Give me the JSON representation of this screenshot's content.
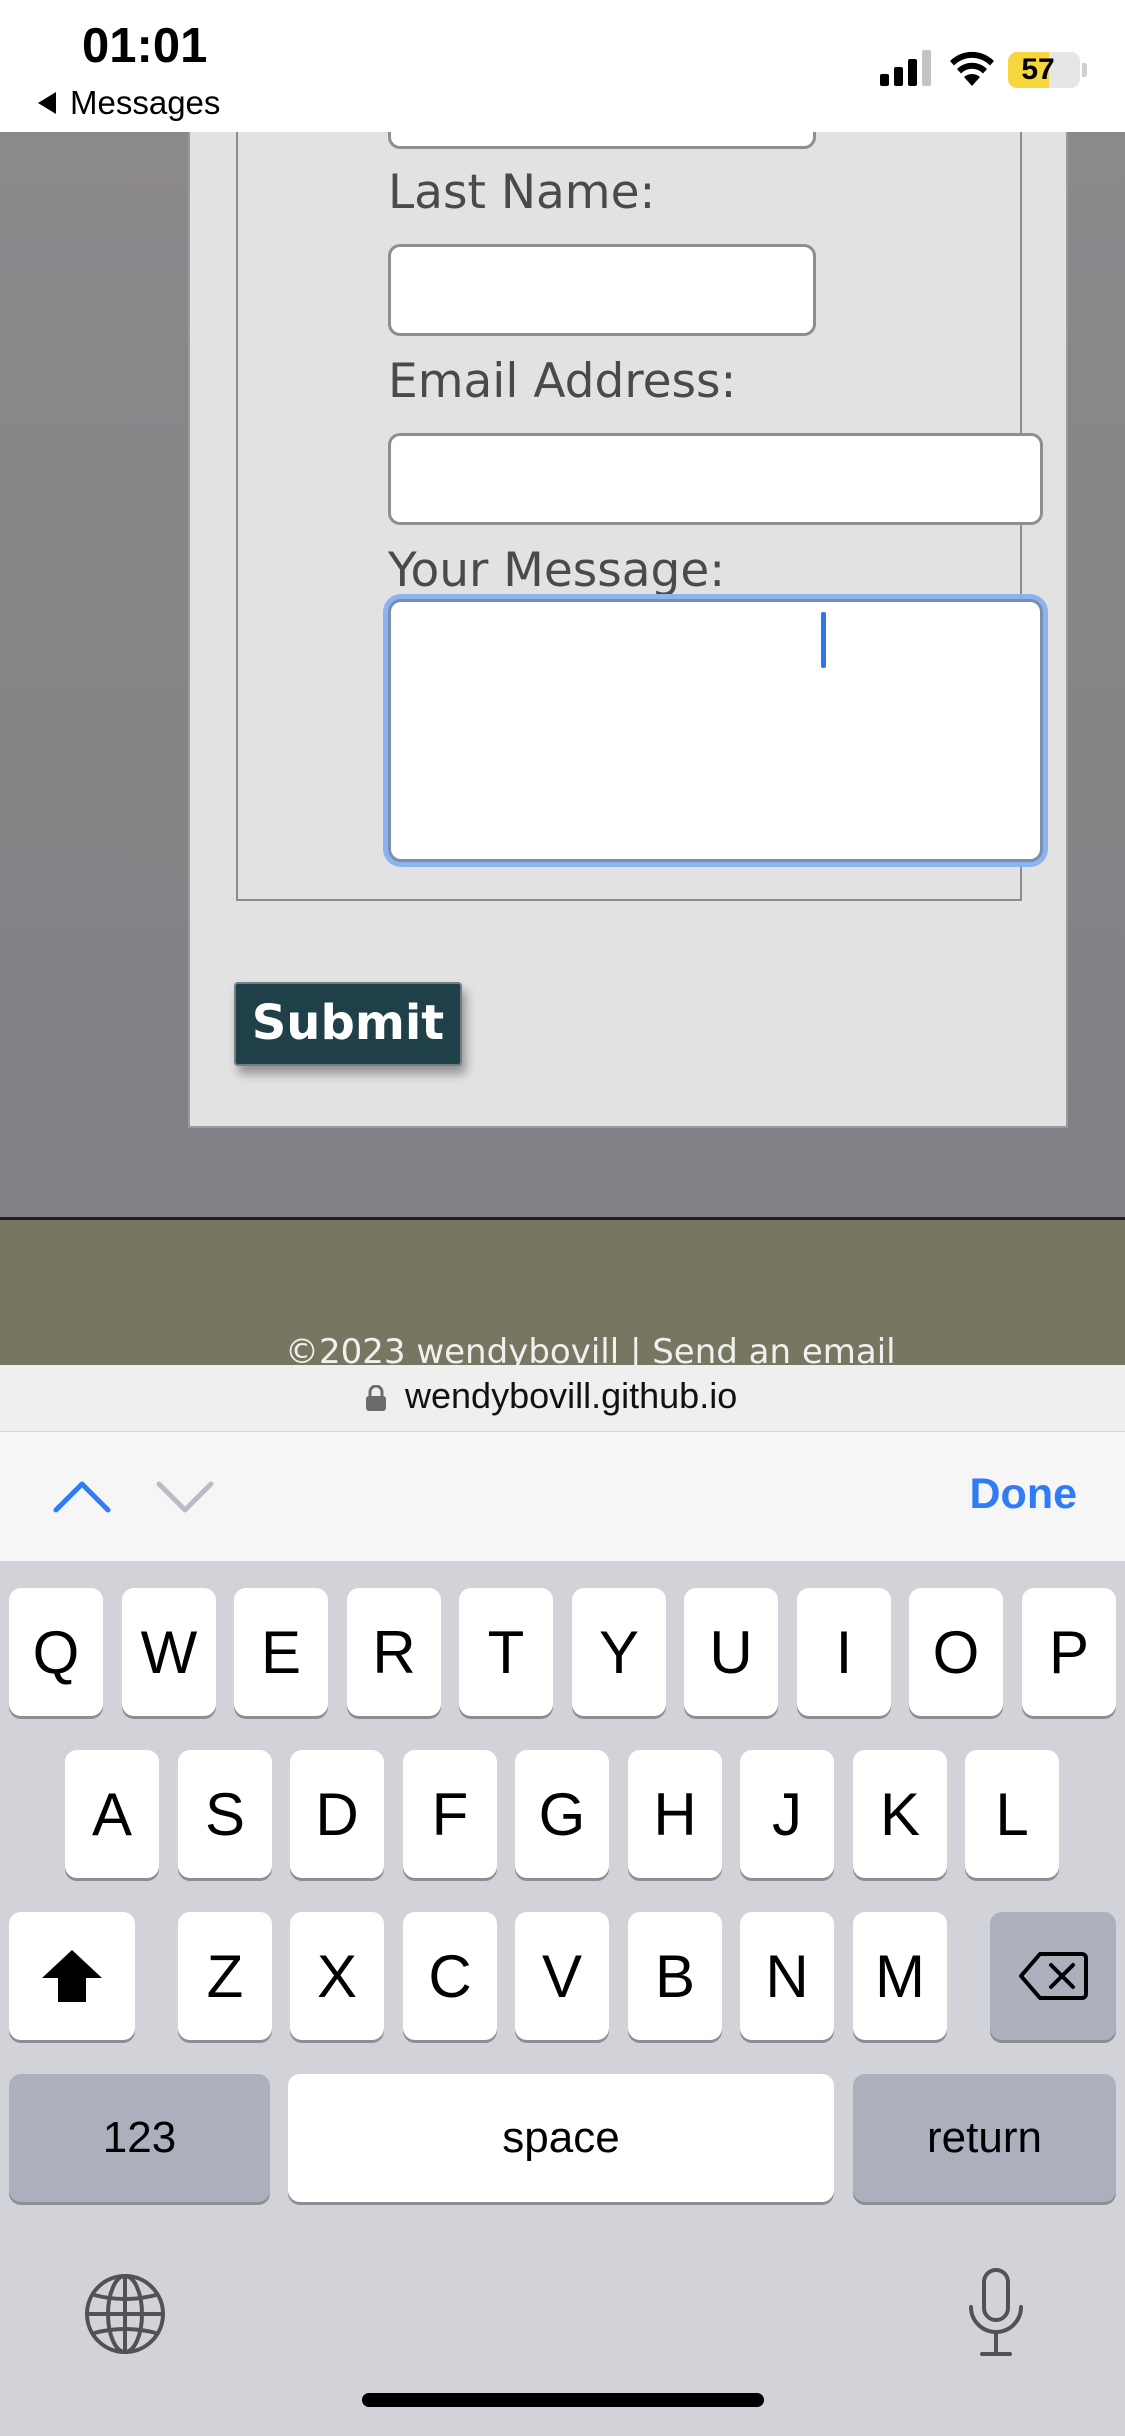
{
  "status_bar": {
    "time": "01:01",
    "back_label": "Messages",
    "battery_level": "57",
    "signal_bars": 3,
    "signal_bars_max": 4
  },
  "form": {
    "last_name_label": "Last Name:",
    "email_label": "Email Address:",
    "message_label": "Your Message:",
    "submit_label": "Submit"
  },
  "footer": {
    "text": "©2023 wendybovill | Send an email"
  },
  "address_bar": {
    "url": "wendybovill.github.io"
  },
  "accessory_bar": {
    "done_label": "Done"
  },
  "keyboard": {
    "row1": [
      "Q",
      "W",
      "E",
      "R",
      "T",
      "Y",
      "U",
      "I",
      "O",
      "P"
    ],
    "row2": [
      "A",
      "S",
      "D",
      "F",
      "G",
      "H",
      "J",
      "K",
      "L"
    ],
    "row3": [
      "Z",
      "X",
      "C",
      "V",
      "B",
      "N",
      "M"
    ],
    "numbers_label": "123",
    "space_label": "space",
    "return_label": "return"
  },
  "colors": {
    "accent": "#2f7cf6",
    "submit_bg": "#1f4049",
    "footer_bg": "#777761",
    "battery_fill": "#f6d53d"
  }
}
